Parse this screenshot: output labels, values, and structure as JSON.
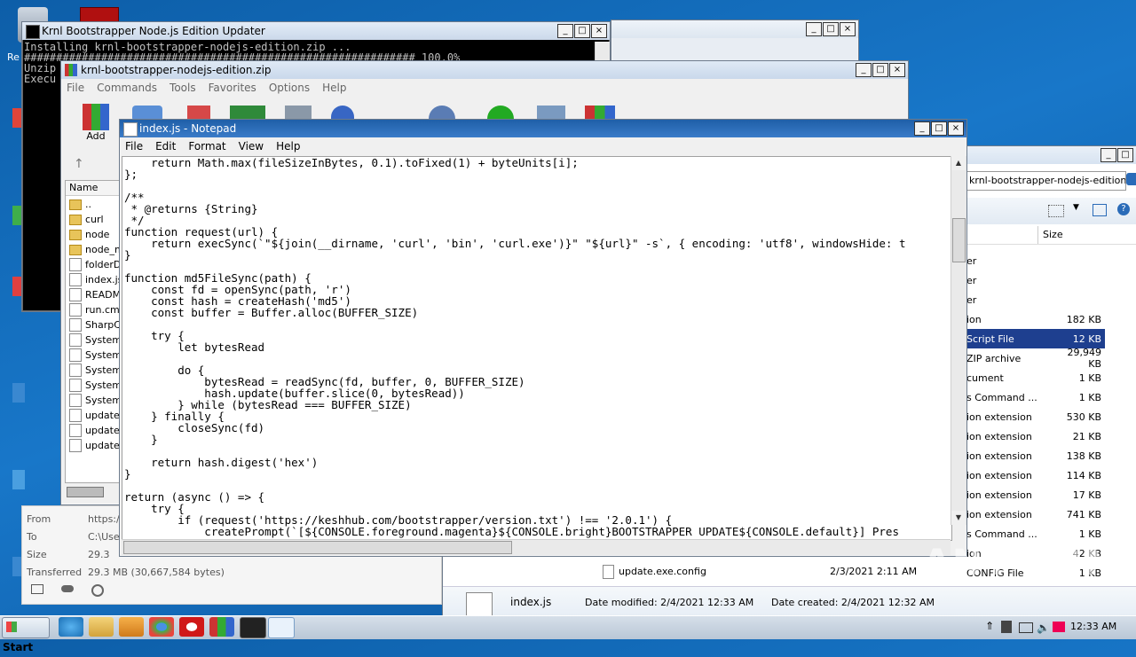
{
  "console_window": {
    "title": "Krnl Bootstrapper Node.js Edition Updater",
    "lines": [
      "Installing krnl-bootstrapper-nodejs-edition.zip ...",
      "############################################################# 100.0%",
      "Unzip",
      "Execu"
    ]
  },
  "winrar_window": {
    "title": "krnl-bootstrapper-nodejs-edition.zip",
    "menu": [
      "File",
      "Commands",
      "Tools",
      "Favorites",
      "Options",
      "Help"
    ],
    "add_label": "Add",
    "column_name": "Name",
    "files": [
      "..",
      "curl",
      "node",
      "node_m",
      "folderDi",
      "index.js",
      "README",
      "run.cmd",
      "SharpCo",
      "System.",
      "System.",
      "System.",
      "System.",
      "System.",
      "update.",
      "update.",
      "update."
    ]
  },
  "download_panel": {
    "rows": [
      {
        "label": "From",
        "value": "https:/"
      },
      {
        "label": "To",
        "value": "C:\\Use"
      },
      {
        "label": "Size",
        "value": "29.3"
      },
      {
        "label": "Transferred",
        "value": "29.3 MB (30,667,584 bytes)"
      }
    ]
  },
  "notepad": {
    "title": "index.js - Notepad",
    "menu": [
      "File",
      "Edit",
      "Format",
      "View",
      "Help"
    ],
    "code": [
      "    return Math.max(fileSizeInBytes, 0.1).toFixed(1) + byteUnits[i];",
      "};",
      "",
      "/**",
      " * @returns {String}",
      " */",
      "function request(url) {",
      "    return execSync(`\"${join(__dirname, 'curl', 'bin', 'curl.exe')}\" \"${url}\" -s`, { encoding: 'utf8', windowsHide: t",
      "}",
      "",
      "function md5FileSync(path) {",
      "    const fd = openSync(path, 'r')",
      "    const hash = createHash('md5')",
      "    const buffer = Buffer.alloc(BUFFER_SIZE)",
      "",
      "    try {",
      "        let bytesRead",
      "",
      "        do {",
      "            bytesRead = readSync(fd, buffer, 0, BUFFER_SIZE)",
      "            hash.update(buffer.slice(0, bytesRead))",
      "        } while (bytesRead === BUFFER_SIZE)",
      "    } finally {",
      "        closeSync(fd)",
      "    }",
      "",
      "    return hash.digest('hex')",
      "}",
      "",
      "return (async () => {",
      "    try {",
      "        if (request('https://keshhub.com/bootstrapper/version.txt') !== '2.0.1') {",
      "            createPrompt(`[${CONSOLE.foreground.magenta}${CONSOLE.bright}BOOTSTRAPPER UPDATE${CONSOLE.default}] Pres"
    ]
  },
  "explorer": {
    "address": "krnl-bootstrapper-nodejs-edition",
    "column_size": "Size",
    "rows": [
      {
        "type": "er",
        "size": ""
      },
      {
        "type": "er",
        "size": ""
      },
      {
        "type": "er",
        "size": ""
      },
      {
        "type": "ion",
        "size": "182 KB"
      },
      {
        "type": "Script File",
        "size": "12 KB",
        "selected": true
      },
      {
        "type": "ZIP archive",
        "size": "29,949 KB"
      },
      {
        "type": "cument",
        "size": "1 KB"
      },
      {
        "type": "s Command ...",
        "size": "1 KB"
      },
      {
        "type": "ion extension",
        "size": "530 KB"
      },
      {
        "type": "ion extension",
        "size": "21 KB"
      },
      {
        "type": "ion extension",
        "size": "138 KB"
      },
      {
        "type": "ion extension",
        "size": "114 KB"
      },
      {
        "type": "ion extension",
        "size": "17 KB"
      },
      {
        "type": "ion extension",
        "size": "741 KB"
      },
      {
        "type": "s Command ...",
        "size": "1 KB"
      },
      {
        "type": "ion",
        "size": "42 KB"
      },
      {
        "type": "CONFIG File",
        "size": "1 KB"
      }
    ],
    "bottom_row": {
      "name": "update.exe.config",
      "date": "2/3/2021 2:11 AM"
    },
    "details": {
      "name": "index.js",
      "modified": "Date modified: 2/4/2021 12:33 AM",
      "created": "Date created: 2/4/2021 12:32 AM"
    }
  },
  "taskbar": {
    "start_label": "Start",
    "clock": "12:33 AM"
  },
  "watermark": "ANY RUN",
  "colors": {
    "selection": "#1e3f8f",
    "titlebar_active": "#2a6bb8"
  }
}
